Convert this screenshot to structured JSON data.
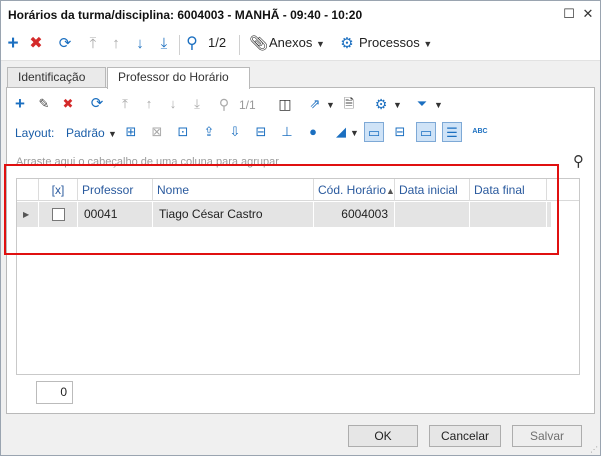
{
  "window": {
    "title": "Horários da turma/disciplina: 6004003 - MANHÃ - 09:40 - 10:20"
  },
  "toolbar_main": {
    "pager": "1/2",
    "anexos_label": "Anexos",
    "processos_label": "Processos"
  },
  "tabs": [
    {
      "label": "Identificação",
      "active": false
    },
    {
      "label": "Professor do Horário",
      "active": true
    }
  ],
  "grid_toolbar": {
    "pager": "1/1",
    "layout_label": "Layout:",
    "layout_value": "Padrão"
  },
  "group_hint": "Arraste aqui o cabeçalho de uma coluna para agrupar",
  "grid": {
    "columns": [
      "[x]",
      "Professor",
      "Nome",
      "Cód. Horário",
      "Data inicial",
      "Data final"
    ],
    "rows": [
      {
        "selected": false,
        "professor": "00041",
        "nome": "Tiago César Castro",
        "cod_horario": "6004003",
        "data_inicial": "",
        "data_final": ""
      }
    ],
    "sort_column": "Cód. Horário",
    "sort_direction": "ascending"
  },
  "record_count": "0",
  "footer": {
    "ok_label": "OK",
    "cancel_label": "Cancelar",
    "save_label": "Salvar"
  },
  "colors": {
    "accent_blue": "#1b6fc0",
    "delete_red": "#d42a2a",
    "highlight_red": "#e01010",
    "header_text": "#2a5a9e"
  }
}
